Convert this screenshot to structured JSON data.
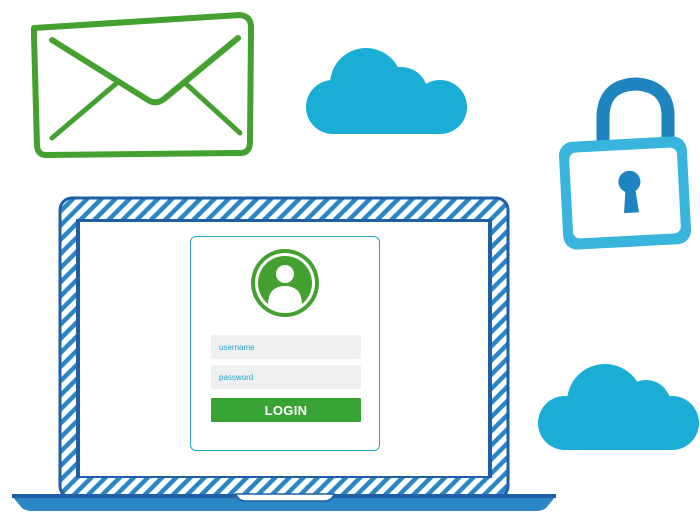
{
  "login_form": {
    "username_placeholder": "username",
    "password_placeholder": "password",
    "login_label": "LOGIN"
  },
  "icons": [
    "envelope-icon",
    "cloud-icon",
    "padlock-icon",
    "user-avatar-icon"
  ],
  "colors": {
    "envelope_green": "#45a12f",
    "cloud_blue": "#1aaed6",
    "lock_shackle_blue": "#1d84bf",
    "lock_body_blue": "#39b4dc",
    "laptop_frame_blue": "#1e5fa6",
    "laptop_stripe": "#2b86c6",
    "login_button_green": "#3aa335",
    "field_gray": "#eef0f2"
  }
}
